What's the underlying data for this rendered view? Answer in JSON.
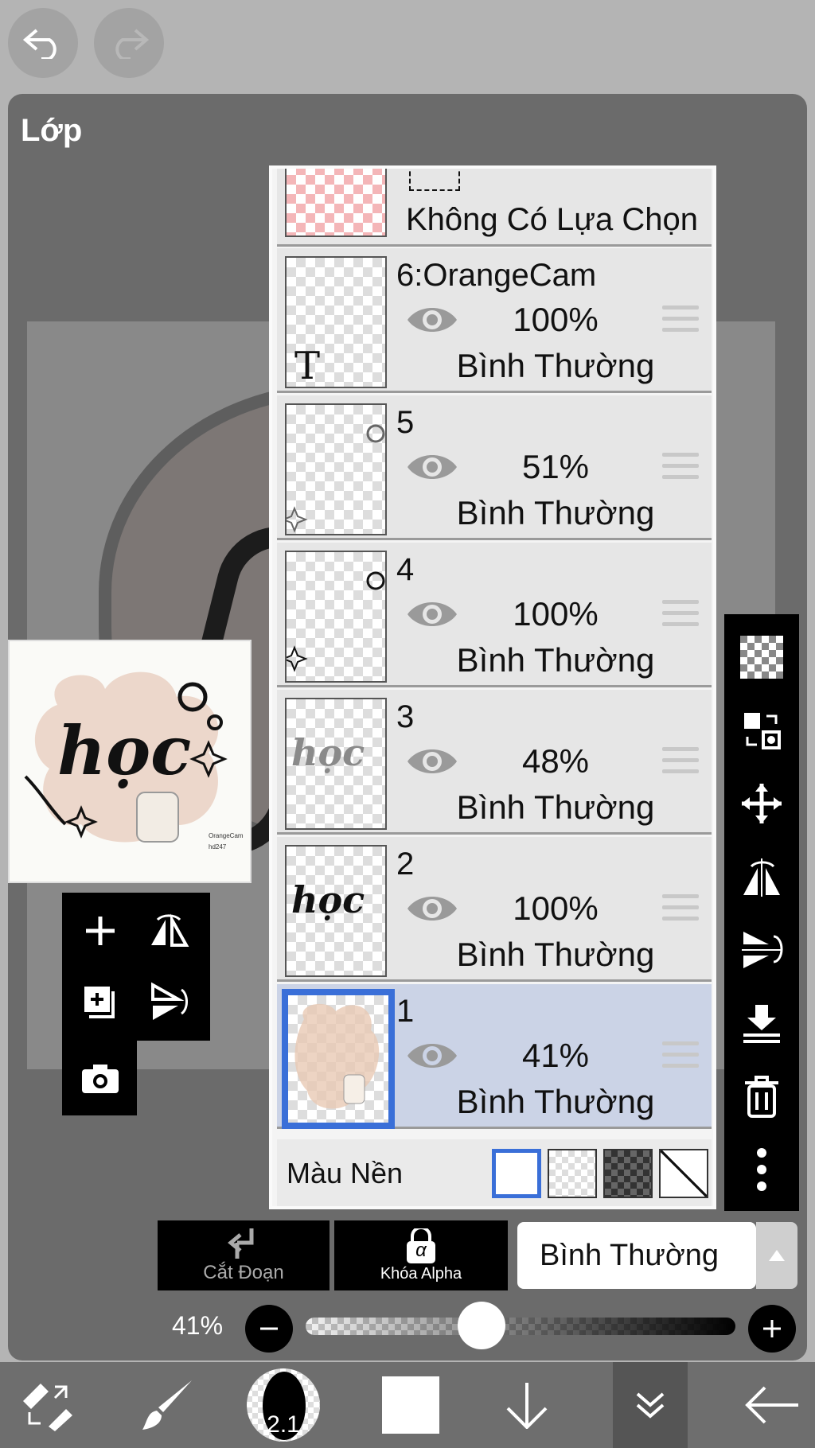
{
  "panel": {
    "title": "Lớp"
  },
  "thumbnail": {
    "word": "học",
    "credit_line1": "OrangeCam",
    "credit_line2": "hd247"
  },
  "selection": {
    "label": "Không Có Lựa Chọn"
  },
  "layers": [
    {
      "name": "6:OrangeCam",
      "opacity": "100%",
      "blend": "Bình Thường",
      "thumb_text": "T",
      "selected": false
    },
    {
      "name": "5",
      "opacity": "51%",
      "blend": "Bình Thường",
      "thumb_text": "",
      "selected": false
    },
    {
      "name": "4",
      "opacity": "100%",
      "blend": "Bình Thường",
      "thumb_text": "",
      "selected": false
    },
    {
      "name": "3",
      "opacity": "48%",
      "blend": "Bình Thường",
      "thumb_text": "học",
      "selected": false
    },
    {
      "name": "2",
      "opacity": "100%",
      "blend": "Bình Thường",
      "thumb_text": "học",
      "selected": false
    },
    {
      "name": "1",
      "opacity": "41%",
      "blend": "Bình Thường",
      "thumb_text": "",
      "selected": true
    }
  ],
  "background": {
    "label": "Màu Nền"
  },
  "bottom_controls": {
    "clip_label": "Cắt Đoạn",
    "alpha_label": "Khóa Alpha",
    "alpha_symbol": "α",
    "blend_mode": "Bình Thường"
  },
  "opacity_slider": {
    "label": "41%",
    "value": 41
  },
  "brush_size": "2.1",
  "colors": {
    "accent": "#3a6fd8",
    "selected_row": "#cbd3e6",
    "panel": "#6b6b6b"
  }
}
